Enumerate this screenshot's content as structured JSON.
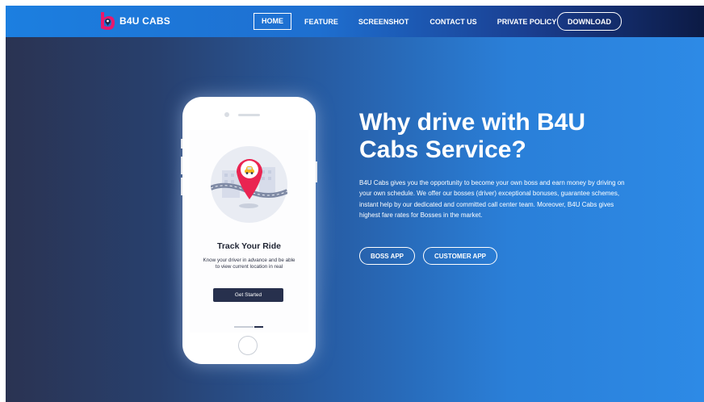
{
  "brand": {
    "name": "B4U CABS",
    "accent": "#e8186d"
  },
  "nav": {
    "items": [
      {
        "label": "HOME",
        "active": true
      },
      {
        "label": "FEATURE",
        "active": false
      },
      {
        "label": "SCREENSHOT",
        "active": false
      },
      {
        "label": "CONTACT US",
        "active": false
      },
      {
        "label": "PRIVATE POLICY",
        "active": false
      }
    ],
    "download_label": "DOWNLOAD"
  },
  "phone": {
    "screen_title": "Track Your Ride",
    "screen_desc": "Know your driver in advance and be able to view current location in real",
    "button_label": "Get Started",
    "pin_color": "#ea2451",
    "button_color": "#27304d"
  },
  "hero": {
    "title": "Why drive with B4U Cabs Service?",
    "body": "B4U Cabs gives you the opportunity to become your own boss and earn money by driving on your own schedule. We offer our bosses (driver) exceptional bonuses, guarantee schemes, instant help by our dedicated and committed call center team. Moreover, B4U Cabs gives highest fare rates for Bosses in the market.",
    "boss_app_label": "BOSS APP",
    "customer_app_label": "CUSTOMER APP"
  },
  "icons": [
    "logo-icon",
    "location-pin-icon",
    "car-icon",
    "home-button-icon"
  ]
}
